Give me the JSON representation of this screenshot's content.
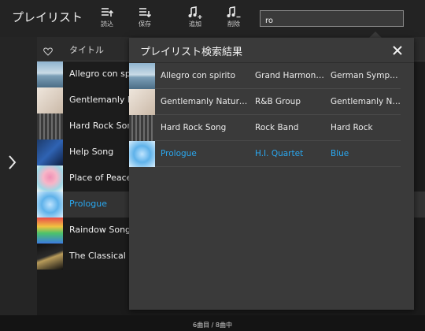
{
  "app": {
    "title": "プレイリスト"
  },
  "toolbar": {
    "buttons": [
      {
        "label": "読込",
        "icon": "playlist-load-icon"
      },
      {
        "label": "保存",
        "icon": "playlist-save-icon"
      },
      {
        "label": "追加",
        "icon": "music-add-icon"
      },
      {
        "label": "削除",
        "icon": "music-remove-icon"
      }
    ],
    "search_value": "ro"
  },
  "list": {
    "header": {
      "favorite_icon": "heart-icon",
      "title_column": "タイトル"
    },
    "tracks": [
      {
        "title": "Allegro con spirito"
      },
      {
        "title": "Gentlemanly Nature"
      },
      {
        "title": "Hard Rock Song"
      },
      {
        "title": "Help Song"
      },
      {
        "title": "Place of Peace Song"
      },
      {
        "title": "Prologue",
        "selected": true
      },
      {
        "title": "Raindow Song"
      },
      {
        "title": "The Classical Song"
      }
    ]
  },
  "status": {
    "text": "6曲目 / 8曲中"
  },
  "popup": {
    "title": "プレイリスト検索結果",
    "results": [
      {
        "title": "Allegro con spirito",
        "artist": "Grand Harmony…",
        "genre": "German Symph…"
      },
      {
        "title": "Gentlemanly Nature…",
        "artist": "R&B Group",
        "genre": "Gentlemanly Na…"
      },
      {
        "title": "Hard Rock Song",
        "artist": "Rock Band",
        "genre": "Hard Rock"
      },
      {
        "title": "Prologue",
        "artist": "H.I. Quartet",
        "genre": "Blue",
        "highlighted": true
      }
    ]
  },
  "colors": {
    "accent": "#2aa8f0",
    "background": "#1c1c1c",
    "popup": "#3a3a3a"
  }
}
